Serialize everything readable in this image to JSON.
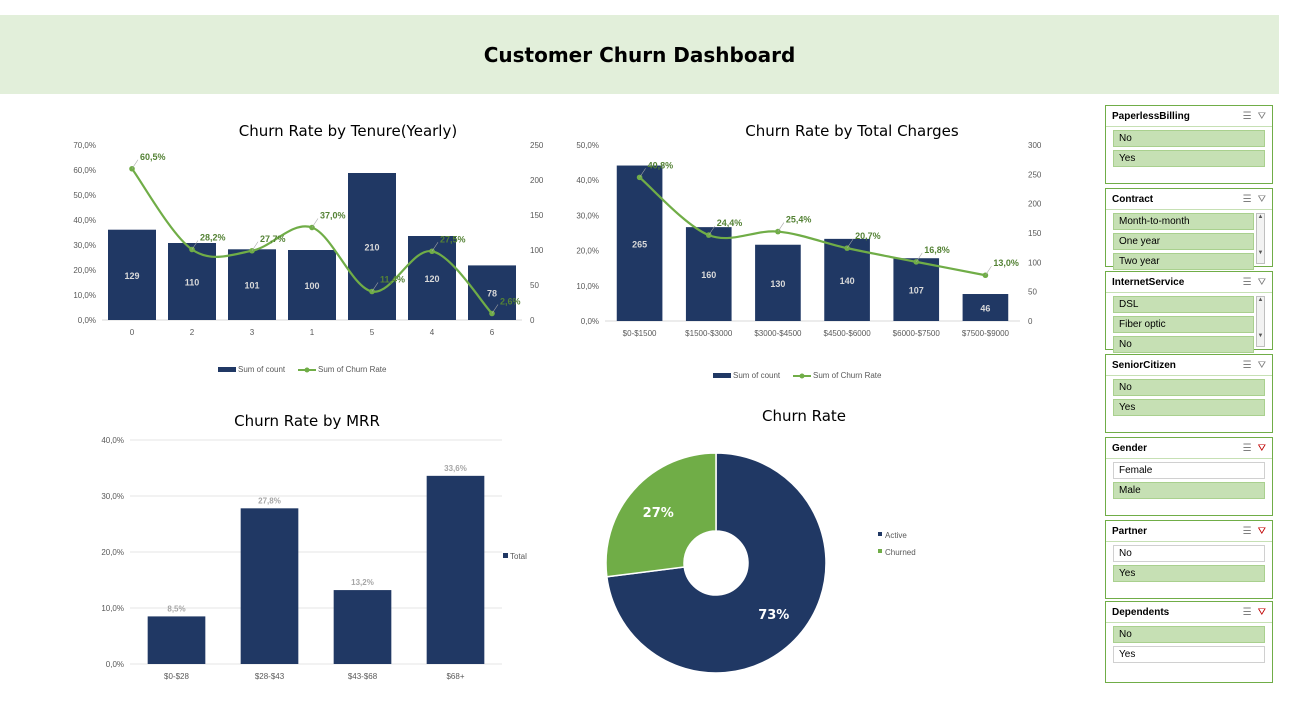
{
  "dashboard": {
    "title": "Customer Churn Dashboard"
  },
  "colors": {
    "navy": "#203864",
    "green": "#70ad47",
    "label_green": "#548235",
    "banner": "#e2efda"
  },
  "chart_data": [
    {
      "id": "tenure",
      "type": "bar",
      "title": "Churn Rate by Tenure(Yearly)",
      "categories": [
        "0",
        "2",
        "3",
        "1",
        "5",
        "4",
        "6"
      ],
      "series": [
        {
          "name": "Sum of count",
          "type": "bar",
          "axis": "right",
          "values": [
            129,
            110,
            101,
            100,
            210,
            120,
            78
          ]
        },
        {
          "name": "Sum of Churn Rate",
          "type": "line",
          "axis": "left",
          "values": [
            60.5,
            28.2,
            27.7,
            37.0,
            11.4,
            27.5,
            2.6
          ],
          "labels": [
            "60,5%",
            "28,2%",
            "27,7%",
            "37,0%",
            "11,4%",
            "27,5%",
            "2,6%"
          ]
        }
      ],
      "y_left": {
        "min": 0,
        "max": 70,
        "ticks": [
          "0,0%",
          "10,0%",
          "20,0%",
          "30,0%",
          "40,0%",
          "50,0%",
          "60,0%",
          "70,0%"
        ]
      },
      "y_right": {
        "min": 0,
        "max": 250,
        "ticks": [
          "0",
          "50",
          "100",
          "150",
          "200",
          "250"
        ]
      },
      "legend": "bottom"
    },
    {
      "id": "charges",
      "type": "bar",
      "title": "Churn Rate by Total Charges",
      "categories": [
        "$0-$1500",
        "$1500-$3000",
        "$3000-$4500",
        "$4500-$6000",
        "$6000-$7500",
        "$7500-$9000"
      ],
      "series": [
        {
          "name": "Sum of count",
          "type": "bar",
          "axis": "right",
          "values": [
            265,
            160,
            130,
            140,
            107,
            46
          ]
        },
        {
          "name": "Sum of Churn Rate",
          "type": "line",
          "axis": "left",
          "values": [
            40.8,
            24.4,
            25.4,
            20.7,
            16.8,
            13.0
          ],
          "labels": [
            "40,8%",
            "24,4%",
            "25,4%",
            "20,7%",
            "16,8%",
            "13,0%"
          ]
        }
      ],
      "y_left": {
        "min": 0,
        "max": 50,
        "ticks": [
          "0,0%",
          "10,0%",
          "20,0%",
          "30,0%",
          "40,0%",
          "50,0%"
        ]
      },
      "y_right": {
        "min": 0,
        "max": 300,
        "ticks": [
          "0",
          "50",
          "100",
          "150",
          "200",
          "250",
          "300"
        ]
      },
      "legend": "bottom"
    },
    {
      "id": "mrr",
      "type": "bar",
      "title": "Churn Rate by MRR",
      "categories": [
        "$0-$28",
        "$28-$43",
        "$43-$68",
        "$68+"
      ],
      "series": [
        {
          "name": "Total",
          "values": [
            8.5,
            27.8,
            13.2,
            33.6
          ],
          "labels": [
            "8,5%",
            "27,8%",
            "13,2%",
            "33,6%"
          ]
        }
      ],
      "y": {
        "min": 0,
        "max": 40,
        "ticks": [
          "0,0%",
          "10,0%",
          "20,0%",
          "30,0%",
          "40,0%"
        ]
      },
      "grid": true,
      "legend": "right"
    },
    {
      "id": "pie",
      "type": "pie",
      "title": "Churn Rate",
      "slices": [
        {
          "name": "Active",
          "value": 73,
          "label": "73%"
        },
        {
          "name": "Churned",
          "value": 27,
          "label": "27%"
        }
      ],
      "legend": "right"
    }
  ],
  "slicers": [
    {
      "title": "PaperlessBilling",
      "filtered": false,
      "items": [
        {
          "label": "No",
          "selected": true
        },
        {
          "label": "Yes",
          "selected": true
        }
      ]
    },
    {
      "title": "Contract",
      "filtered": false,
      "scroll": true,
      "items": [
        {
          "label": "Month-to-month",
          "selected": true
        },
        {
          "label": "One year",
          "selected": true
        },
        {
          "label": "Two year",
          "selected": true
        }
      ]
    },
    {
      "title": "InternetService",
      "filtered": false,
      "scroll": true,
      "items": [
        {
          "label": "DSL",
          "selected": true
        },
        {
          "label": "Fiber optic",
          "selected": true
        },
        {
          "label": "No",
          "selected": true
        }
      ]
    },
    {
      "title": "SeniorCitizen",
      "filtered": false,
      "items": [
        {
          "label": "No",
          "selected": true
        },
        {
          "label": "Yes",
          "selected": true
        }
      ]
    },
    {
      "title": "Gender",
      "filtered": true,
      "items": [
        {
          "label": "Female",
          "selected": false
        },
        {
          "label": "Male",
          "selected": true
        }
      ]
    },
    {
      "title": "Partner",
      "filtered": true,
      "items": [
        {
          "label": "No",
          "selected": false
        },
        {
          "label": "Yes",
          "selected": true
        }
      ]
    },
    {
      "title": "Dependents",
      "filtered": true,
      "items": [
        {
          "label": "No",
          "selected": true
        },
        {
          "label": "Yes",
          "selected": false
        }
      ]
    }
  ]
}
